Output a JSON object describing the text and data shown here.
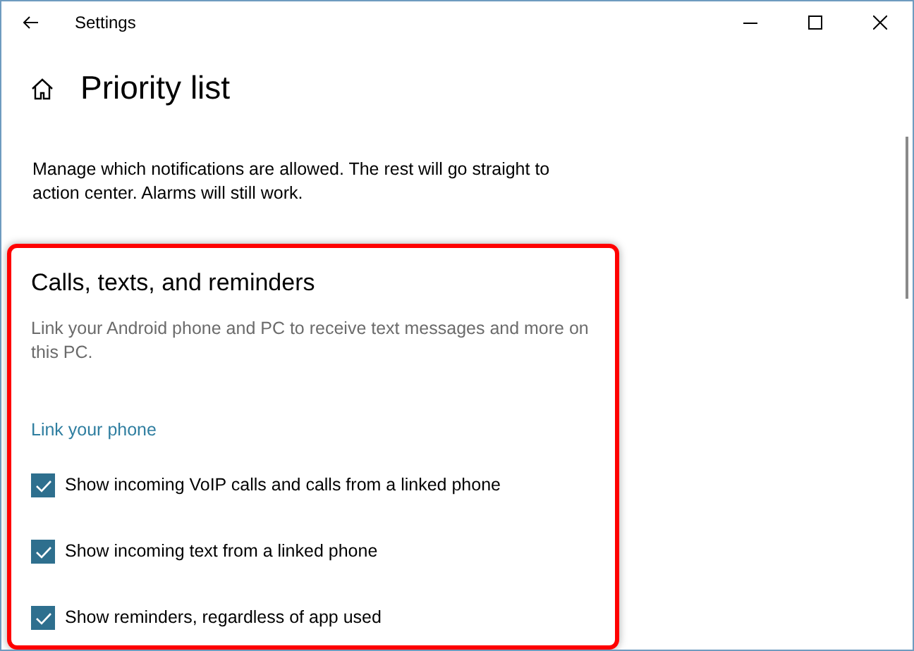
{
  "window": {
    "title": "Settings"
  },
  "page": {
    "title": "Priority list",
    "description": "Manage which notifications are allowed. The rest will go straight to action center. Alarms will still work."
  },
  "section": {
    "title": "Calls, texts, and reminders",
    "description": "Link your Android phone and PC to receive text messages and more on this PC.",
    "link": "Link your phone",
    "options": [
      {
        "label": "Show incoming VoIP calls and calls from a linked phone",
        "checked": true
      },
      {
        "label": "Show incoming text from a linked phone",
        "checked": true
      },
      {
        "label": "Show reminders, regardless of app used",
        "checked": true
      }
    ]
  }
}
